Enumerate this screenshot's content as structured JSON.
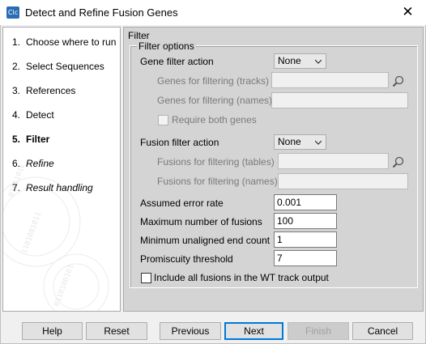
{
  "window": {
    "title": "Detect and Refine Fusion Genes",
    "icon_text": "Clc",
    "close_glyph": "✕"
  },
  "steps": [
    {
      "num": "1.",
      "label": "Choose where to run",
      "state": "normal"
    },
    {
      "num": "2.",
      "label": "Select Sequences",
      "state": "normal"
    },
    {
      "num": "3.",
      "label": "References",
      "state": "normal"
    },
    {
      "num": "4.",
      "label": "Detect",
      "state": "normal"
    },
    {
      "num": "5.",
      "label": "Filter",
      "state": "active"
    },
    {
      "num": "6.",
      "label": "Refine",
      "state": "future"
    },
    {
      "num": "7.",
      "label": "Result handling",
      "state": "future"
    }
  ],
  "panel": {
    "title": "Filter",
    "group_title": "Filter options",
    "gene_filter_action": {
      "label": "Gene filter action",
      "value": "None"
    },
    "genes_tracks": {
      "label": "Genes for filtering (tracks)",
      "value": ""
    },
    "genes_names": {
      "label": "Genes for filtering (names)",
      "value": ""
    },
    "require_both": {
      "label": "Require both genes",
      "checked": false
    },
    "fusion_filter_action": {
      "label": "Fusion filter action",
      "value": "None"
    },
    "fusions_tables": {
      "label": "Fusions for filtering (tables)",
      "value": ""
    },
    "fusions_names": {
      "label": "Fusions for filtering (names)",
      "value": ""
    },
    "error_rate": {
      "label": "Assumed error rate",
      "value": "0.001"
    },
    "max_fusions": {
      "label": "Maximum number of fusions",
      "value": "100"
    },
    "min_unaligned": {
      "label": "Minimum unaligned end count",
      "value": "1"
    },
    "promiscuity": {
      "label": "Promiscuity threshold",
      "value": "7"
    },
    "include_wt": {
      "label": "Include all fusions in the WT track output",
      "checked": false
    }
  },
  "buttons": {
    "help": "Help",
    "reset": "Reset",
    "previous": "Previous",
    "next": "Next",
    "finish": "Finish",
    "cancel": "Cancel"
  },
  "icons": {
    "browse": "magnifier-folder-icon",
    "dropdown": "chevron-down-icon",
    "close": "close-icon"
  },
  "colors": {
    "accent": "#0078d7",
    "panel_bg": "#d4d4d4",
    "dialog_bg": "#f0f0f0"
  }
}
